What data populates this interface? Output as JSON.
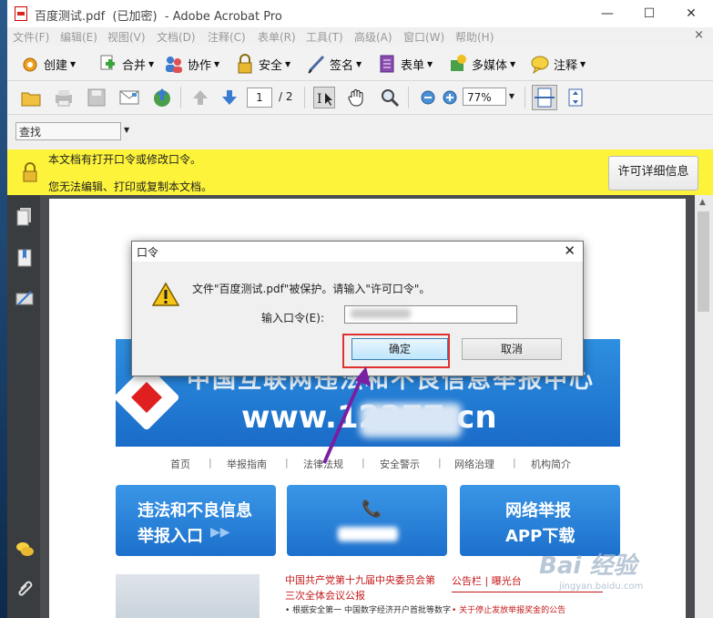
{
  "window": {
    "file_name": "百度测试.pdf",
    "encrypted_tag": "(已加密)",
    "app_name": "- Adobe Acrobat Pro",
    "minimize": "—",
    "maximize": "☐",
    "close": "✕"
  },
  "menu": {
    "items": [
      "文件(F)",
      "编辑(E)",
      "视图(V)",
      "文档(D)",
      "注释(C)",
      "表单(R)",
      "工具(T)",
      "高级(A)",
      "窗口(W)",
      "帮助(H)"
    ],
    "close_glyph": "×"
  },
  "toolbar": {
    "create": "创建",
    "combine": "合并",
    "collaborate": "协作",
    "secure": "安全",
    "sign": "签名",
    "forms": "表单",
    "multimedia": "多媒体",
    "comment": "注释"
  },
  "navbar": {
    "current_page": "1",
    "total_pages": "/ 2",
    "zoom": "77%"
  },
  "find": {
    "label": "查找"
  },
  "info_bar": {
    "line1": "本文档有打开口令或修改口令。",
    "line2": "您无法编辑、打印或复制本文档。",
    "permission_button": "许可详细信息"
  },
  "document": {
    "banner_title": "中国互联网违法和不良信息举报中心",
    "banner_url": "www.12377.cn",
    "nav": [
      "首页",
      "举报指南",
      "法律法规",
      "安全警示",
      "网络治理",
      "机构简介"
    ],
    "tiles": [
      {
        "line1": "违法和不良信息",
        "line2": "举报入口"
      },
      {
        "phone": "📞"
      },
      {
        "line1": "网络举报",
        "line2": "APP下载"
      }
    ],
    "news_line1": "中国共产党第十九届中央委员会第",
    "news_line2": "三次全体会议公报",
    "news_line3": "• 根据安全第一 中国数字经济开户首批等数字",
    "notice_title": "公告栏 | 曝光台",
    "notice_item": "• 关于停止发放举报奖金的公告"
  },
  "dialog": {
    "title": "口令",
    "message": "文件\"百度测试.pdf\"被保护。请输入\"许可口令\"。",
    "password_label": "输入口令(E):",
    "ok_button": "确定",
    "cancel_button": "取消"
  },
  "watermark": {
    "brand": "Bai 经验",
    "url": "jingyan.baidu.com"
  },
  "colors": {
    "info_bar": "#fcf33a",
    "annotation_red": "#e03030",
    "annotation_arrow": "#7a1fa2",
    "banner_blue": "#1a6cc8"
  }
}
